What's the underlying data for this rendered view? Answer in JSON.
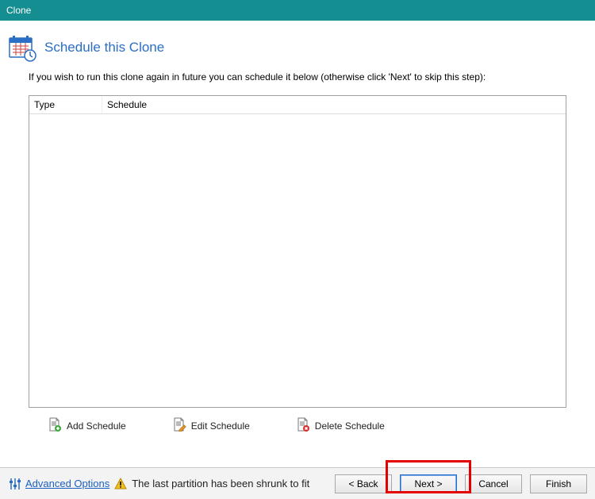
{
  "window": {
    "title": "Clone"
  },
  "header": {
    "title": "Schedule this Clone"
  },
  "description": "If you wish to run this clone again in future you can schedule it below (otherwise click 'Next' to skip this step):",
  "table": {
    "columns": {
      "type": "Type",
      "schedule": "Schedule"
    },
    "rows": []
  },
  "actions": {
    "add": "Add Schedule",
    "edit": "Edit Schedule",
    "delete": "Delete Schedule"
  },
  "footer": {
    "advanced": "Advanced Options",
    "status": "The last partition has been shrunk to fit",
    "back": "< Back",
    "next": "Next >",
    "cancel": "Cancel",
    "finish": "Finish"
  }
}
